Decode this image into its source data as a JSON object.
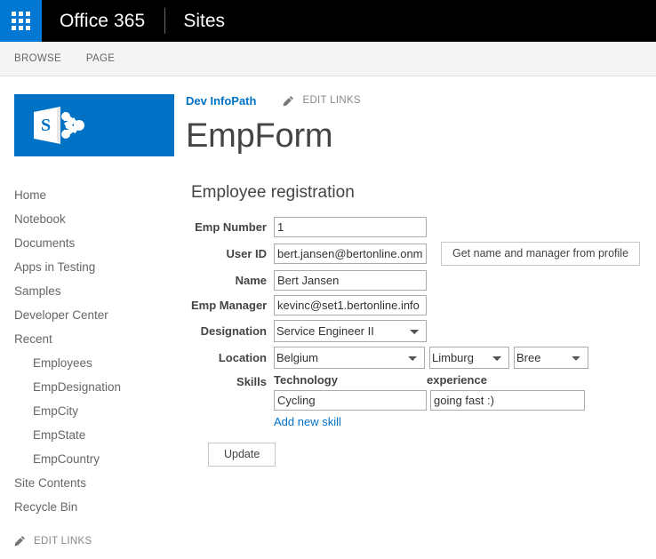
{
  "suite": {
    "waffle_icon": "app-launcher-waffle-icon",
    "brand": "Office 365",
    "app": "Sites"
  },
  "ribbon": {
    "tabs": [
      {
        "label": "BROWSE"
      },
      {
        "label": "PAGE"
      }
    ]
  },
  "site_logo": {
    "icon": "sharepoint-logo-icon",
    "letter": "S",
    "bg_color": "#0072c6"
  },
  "quicklaunch": {
    "items": [
      {
        "label": "Home",
        "sub": false
      },
      {
        "label": "Notebook",
        "sub": false
      },
      {
        "label": "Documents",
        "sub": false
      },
      {
        "label": "Apps in Testing",
        "sub": false
      },
      {
        "label": "Samples",
        "sub": false
      },
      {
        "label": "Developer Center",
        "sub": false
      },
      {
        "label": "Recent",
        "sub": false
      },
      {
        "label": "Employees",
        "sub": true
      },
      {
        "label": "EmpDesignation",
        "sub": true
      },
      {
        "label": "EmpCity",
        "sub": true
      },
      {
        "label": "EmpState",
        "sub": true
      },
      {
        "label": "EmpCountry",
        "sub": true
      },
      {
        "label": "Site Contents",
        "sub": false
      },
      {
        "label": "Recycle Bin",
        "sub": false
      }
    ],
    "edit_links": "EDIT LINKS",
    "edit_links_icon": "pencil-icon"
  },
  "header": {
    "breadcrumb": "Dev InfoPath",
    "edit_links": "EDIT LINKS",
    "edit_links_icon": "pencil-icon",
    "title": "EmpForm",
    "link_color": "#0072c6"
  },
  "form": {
    "heading": "Employee registration",
    "fields": {
      "emp_number": {
        "label": "Emp Number",
        "value": "1"
      },
      "user_id": {
        "label": "User ID",
        "value": "bert.jansen@bertonline.onmicrosoft.com"
      },
      "name": {
        "label": "Name",
        "value": "Bert Jansen"
      },
      "emp_manager": {
        "label": "Emp Manager",
        "value": "kevinc@set1.bertonline.info"
      },
      "designation": {
        "label": "Designation",
        "value": "Service Engineer II",
        "options": [
          "Service Engineer II"
        ]
      },
      "location": {
        "label": "Location",
        "country": {
          "value": "Belgium",
          "options": [
            "Belgium"
          ]
        },
        "state": {
          "value": "Limburg",
          "options": [
            "Limburg"
          ]
        },
        "city": {
          "value": "Bree",
          "options": [
            "Bree"
          ]
        }
      },
      "skills": {
        "label": "Skills",
        "columns": [
          "Technology",
          "experience"
        ],
        "rows": [
          {
            "technology": "Cycling",
            "experience": "going fast :)"
          }
        ],
        "add_link": "Add new skill"
      }
    },
    "buttons": {
      "get_profile": "Get name and manager from profile",
      "update": "Update"
    }
  }
}
